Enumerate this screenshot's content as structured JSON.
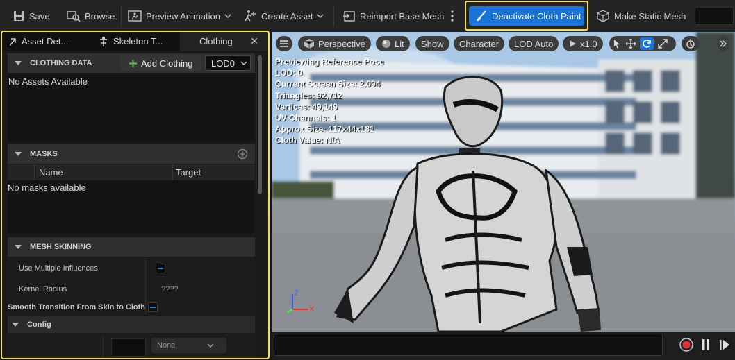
{
  "toolbar": {
    "save": "Save",
    "browse": "Browse",
    "preview_animation": "Preview Animation",
    "create_asset": "Create Asset",
    "reimport": "Reimport Base Mesh",
    "deactivate_cloth_paint": "Deactivate Cloth Paint",
    "make_static_mesh": "Make Static Mesh"
  },
  "tabs": [
    "Asset Det...",
    "Skeleton T...",
    "Clothing"
  ],
  "clothing_data": {
    "title": "CLOTHING DATA",
    "add_clothing": "Add Clothing",
    "lod_selected": "LOD0",
    "empty": "No Assets Available"
  },
  "masks": {
    "title": "MASKS",
    "col_name": "Name",
    "col_target": "Target",
    "empty": "No masks available"
  },
  "mesh_skinning": {
    "title": "MESH SKINNING",
    "use_multiple_influences": "Use Multiple Influences",
    "kernel_radius": "Kernel Radius",
    "kernel_radius_value": "????",
    "smooth_transition": "Smooth Transition From Skin to Cloth"
  },
  "config": {
    "title": "Config",
    "dropdown_value": "None"
  },
  "viewport": {
    "perspective": "Perspective",
    "lit": "Lit",
    "show": "Show",
    "character": "Character",
    "lod_auto": "LOD Auto",
    "play_speed": "x1.0",
    "stats": [
      "Previewing Reference Pose",
      "LOD: 0",
      "Current Screen Size: 2.094",
      "Triangles: 92,712",
      "Vertices: 49,149",
      "UV Channels: 1",
      "Approx Size: 117x44x181",
      "Cloth Value: N/A"
    ],
    "axis_z": "Z",
    "axis_x": "X"
  },
  "colors": {
    "highlight": "#f5e04a",
    "active_button": "#1a74d8",
    "checkbox_indicator": "#2d7fd6"
  }
}
